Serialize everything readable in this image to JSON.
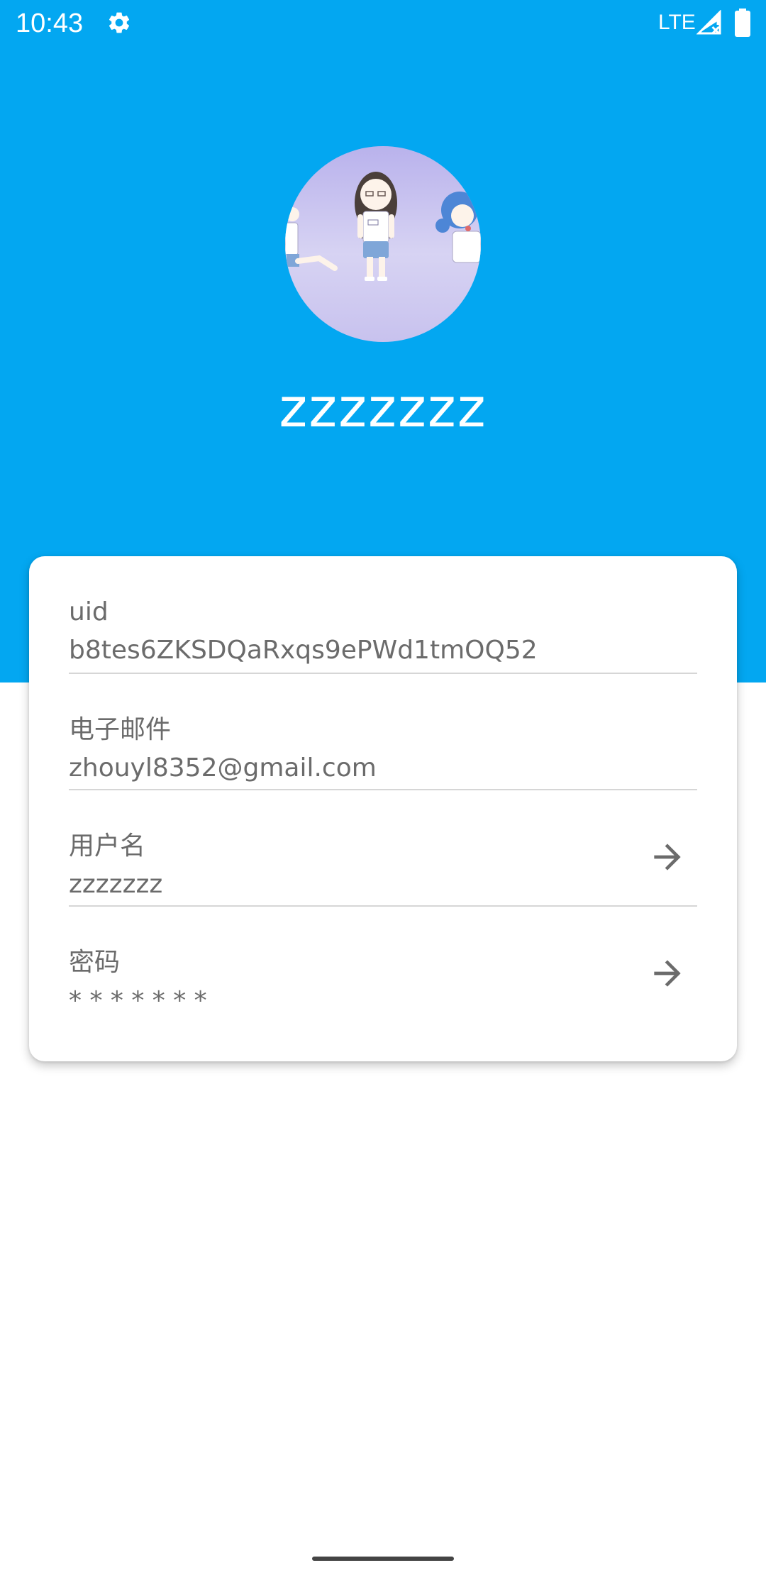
{
  "status_bar": {
    "time": "10:43",
    "network": "LTE",
    "icons": [
      "settings-icon",
      "signal-icon",
      "battery-icon"
    ]
  },
  "profile": {
    "name": "zzzzzzz",
    "avatar": "avatar-image"
  },
  "account_info": {
    "uid": {
      "label": "uid",
      "value": "b8tes6ZKSDQaRxqs9ePWd1tmOQ52"
    },
    "email": {
      "label": "电子邮件",
      "value": "zhouyl8352@gmail.com"
    },
    "username": {
      "label": "用户名",
      "value": "zzzzzzz",
      "action_icon": "arrow-right-icon"
    },
    "password": {
      "label": "密码",
      "value": "* * * * * * *",
      "action_icon": "arrow-right-icon"
    }
  },
  "colors": {
    "header_background": "#03A7F1",
    "card_background": "#FFFFFF",
    "text_secondary": "#6B6B6B",
    "divider": "#D6D6D6"
  }
}
